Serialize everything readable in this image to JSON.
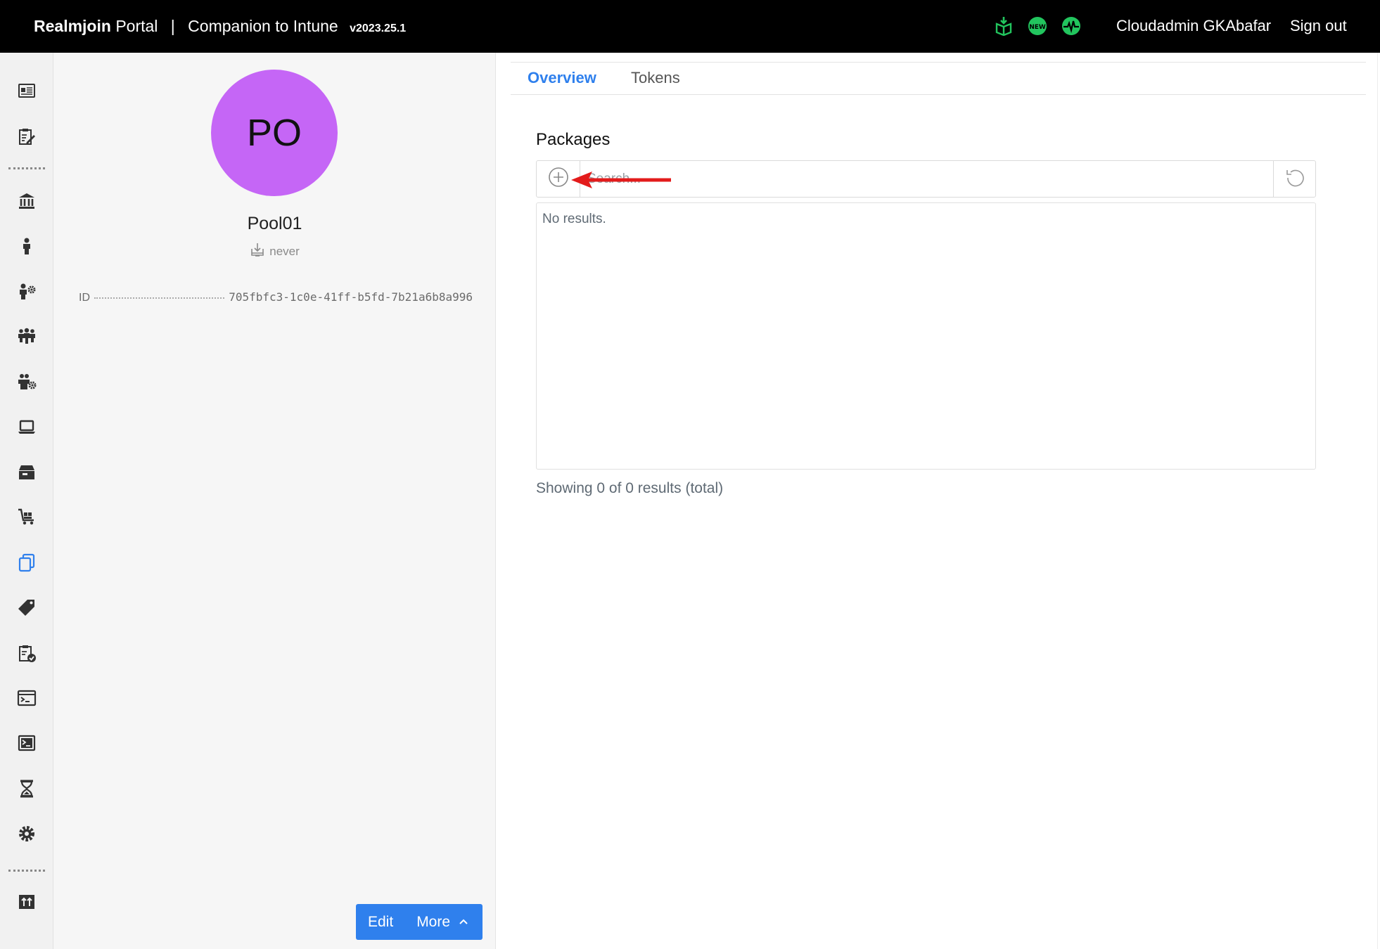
{
  "header": {
    "brand_bold": "Realmjoin",
    "brand_rest": "Portal",
    "separator": "|",
    "subtitle": "Companion to Intune",
    "version": "v2023.25.1",
    "status_icons": [
      "package-icon",
      "new-badge-icon",
      "heartbeat-icon"
    ],
    "status_color": "#22c55e",
    "user": "Cloudadmin GKAbafar",
    "signout_label": "Sign out"
  },
  "sidebar": {
    "items": [
      {
        "icon": "id-card-icon"
      },
      {
        "icon": "clipboard-edit-icon"
      },
      {
        "icon": "bank-icon"
      },
      {
        "icon": "user-icon"
      },
      {
        "icon": "user-settings-icon"
      },
      {
        "icon": "users-group-icon"
      },
      {
        "icon": "users-settings-icon"
      },
      {
        "icon": "laptop-icon"
      },
      {
        "icon": "package-box-icon"
      },
      {
        "icon": "cart-icon"
      },
      {
        "icon": "copy-icon",
        "active": true
      },
      {
        "icon": "tag-icon"
      },
      {
        "icon": "clipboard-check-icon"
      },
      {
        "icon": "terminal-window-icon"
      },
      {
        "icon": "console-icon"
      },
      {
        "icon": "hourglass-icon"
      },
      {
        "icon": "gear-icon"
      },
      {
        "icon": "upload-icon"
      }
    ],
    "active_color": "#2f80ed"
  },
  "profile": {
    "avatar_initials": "PO",
    "avatar_color": "#c566f6",
    "name": "Pool01",
    "sync_status": "never",
    "id_label": "ID",
    "id_value": "705fbfc3-1c0e-41ff-b5fd-7b21a6b8a996",
    "edit_label": "Edit",
    "more_label": "More"
  },
  "tabs": [
    {
      "label": "Overview",
      "active": true
    },
    {
      "label": "Tokens",
      "active": false
    }
  ],
  "packages": {
    "title": "Packages",
    "search_placeholder": "Search...",
    "no_results": "No results.",
    "results_count": "Showing 0 of 0 results (total)"
  },
  "annotation": {
    "arrow_color": "#e31b1b"
  }
}
